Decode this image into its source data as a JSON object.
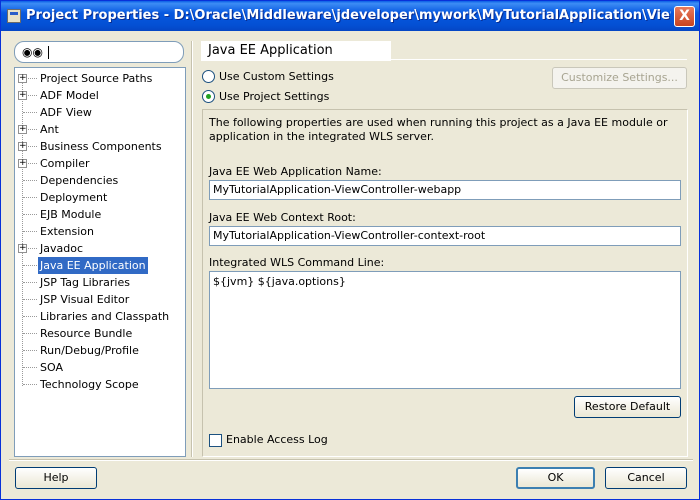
{
  "window": {
    "title": "Project Properties - D:\\Oracle\\Middleware\\jdeveloper\\mywork\\MyTutorialApplication\\ViewController\\...",
    "close_label": "X"
  },
  "search": {
    "icon": "binoculars-icon",
    "placeholder": ""
  },
  "tree": {
    "items": [
      {
        "label": "Project Source Paths",
        "expandable": true,
        "selected": false
      },
      {
        "label": "ADF Model",
        "expandable": true,
        "selected": false
      },
      {
        "label": "ADF View",
        "expandable": false,
        "selected": false
      },
      {
        "label": "Ant",
        "expandable": true,
        "selected": false
      },
      {
        "label": "Business Components",
        "expandable": true,
        "selected": false
      },
      {
        "label": "Compiler",
        "expandable": true,
        "selected": false
      },
      {
        "label": "Dependencies",
        "expandable": false,
        "selected": false
      },
      {
        "label": "Deployment",
        "expandable": false,
        "selected": false
      },
      {
        "label": "EJB Module",
        "expandable": false,
        "selected": false
      },
      {
        "label": "Extension",
        "expandable": false,
        "selected": false
      },
      {
        "label": "Javadoc",
        "expandable": true,
        "selected": false
      },
      {
        "label": "Java EE Application",
        "expandable": false,
        "selected": true
      },
      {
        "label": "JSP Tag Libraries",
        "expandable": false,
        "selected": false
      },
      {
        "label": "JSP Visual Editor",
        "expandable": false,
        "selected": false
      },
      {
        "label": "Libraries and Classpath",
        "expandable": false,
        "selected": false
      },
      {
        "label": "Resource Bundle",
        "expandable": false,
        "selected": false
      },
      {
        "label": "Run/Debug/Profile",
        "expandable": false,
        "selected": false
      },
      {
        "label": "SOA",
        "expandable": false,
        "selected": false
      },
      {
        "label": "Technology Scope",
        "expandable": false,
        "selected": false
      }
    ]
  },
  "page": {
    "heading": "Java EE Application",
    "radio_custom": "Use Custom Settings",
    "radio_project": "Use Project Settings",
    "customize_button": "Customize Settings...",
    "description": "The following properties are used when running this project as a Java EE module or application in the integrated WLS server.",
    "web_app_name_label": "Java EE Web Application Name:",
    "web_app_name_value": "MyTutorialApplication-ViewController-webapp",
    "context_root_label": "Java EE Web Context Root:",
    "context_root_value": "MyTutorialApplication-ViewController-context-root",
    "command_line_label": "Integrated WLS Command Line:",
    "command_line_value": "${jvm} ${java.options}",
    "restore_default_button": "Restore Default",
    "enable_access_log_label": "Enable Access Log",
    "enable_access_log_checked": false
  },
  "footer": {
    "help_button": "Help",
    "ok_button": "OK",
    "cancel_button": "Cancel"
  }
}
